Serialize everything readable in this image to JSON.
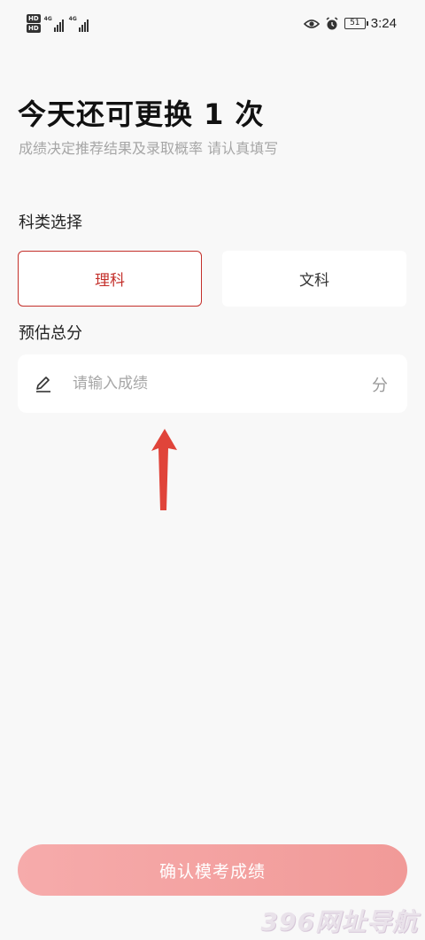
{
  "status_bar": {
    "hd_badge_1": "HD",
    "hd_badge_2": "HD",
    "network_1": "4G",
    "network_2": "4G",
    "battery": "51",
    "time": "3:24"
  },
  "header": {
    "title": "今天还可更换 1 次",
    "subtitle": "成绩决定推荐结果及录取概率  请认真填写"
  },
  "subject": {
    "label": "科类选择",
    "options": [
      {
        "label": "理科",
        "selected": true
      },
      {
        "label": "文科",
        "selected": false
      }
    ]
  },
  "score": {
    "label": "预估总分",
    "value": "",
    "placeholder": "请输入成绩",
    "unit": "分"
  },
  "confirm_label": "确认模考成绩",
  "watermark": "396网址导航",
  "colors": {
    "accent": "#c4302b",
    "button_gradient_start": "#f6abab",
    "button_gradient_end": "#f19a98",
    "annotation_arrow": "#e0443a",
    "background": "#f8f8f8"
  },
  "icons": [
    "hd-icon",
    "signal-icon",
    "eye-icon",
    "alarm-icon",
    "battery-icon",
    "pencil-icon",
    "annotation-arrow-icon"
  ]
}
